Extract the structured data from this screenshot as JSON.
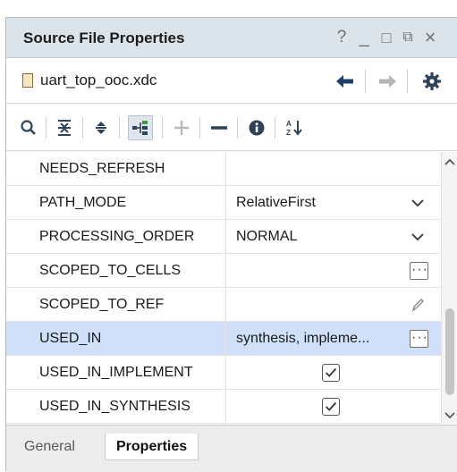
{
  "window": {
    "title": "Source File Properties",
    "controls": {
      "help": "?",
      "minimize": "_",
      "maximize": "□",
      "restore": "⧉",
      "close": "×"
    }
  },
  "file": {
    "name": "uart_top_ooc.xdc"
  },
  "toolbar": {
    "buttons": [
      "search-icon",
      "collapse-all-icon",
      "expand-all-icon",
      "show-hierarchy-icon",
      "add-icon",
      "remove-icon",
      "info-icon",
      "sort-icon"
    ],
    "active": "show-hierarchy-icon"
  },
  "table": {
    "rows": [
      {
        "name": "NEEDS_REFRESH",
        "value": "",
        "editor": "none"
      },
      {
        "name": "PATH_MODE",
        "value": "RelativeFirst",
        "editor": "dropdown"
      },
      {
        "name": "PROCESSING_ORDER",
        "value": "NORMAL",
        "editor": "dropdown"
      },
      {
        "name": "SCOPED_TO_CELLS",
        "value": "",
        "editor": "ellipsis"
      },
      {
        "name": "SCOPED_TO_REF",
        "value": "",
        "editor": "pencil"
      },
      {
        "name": "USED_IN",
        "value": "synthesis, impleme...",
        "editor": "ellipsis",
        "selected": true
      },
      {
        "name": "USED_IN_IMPLEMENTATION",
        "display": "USED_IN_IMPLEMENT",
        "value": "",
        "editor": "checkbox",
        "checked": true
      },
      {
        "name": "USED_IN_SYNTHESIS",
        "value": "",
        "editor": "checkbox",
        "checked": true
      }
    ]
  },
  "tabs": [
    {
      "label": "General",
      "active": false
    },
    {
      "label": "Properties",
      "active": true
    }
  ],
  "colors": {
    "title_bg": "#dbe3eb",
    "selected_row": "#cfe0f8",
    "accent_text": "#1a1a1a"
  }
}
